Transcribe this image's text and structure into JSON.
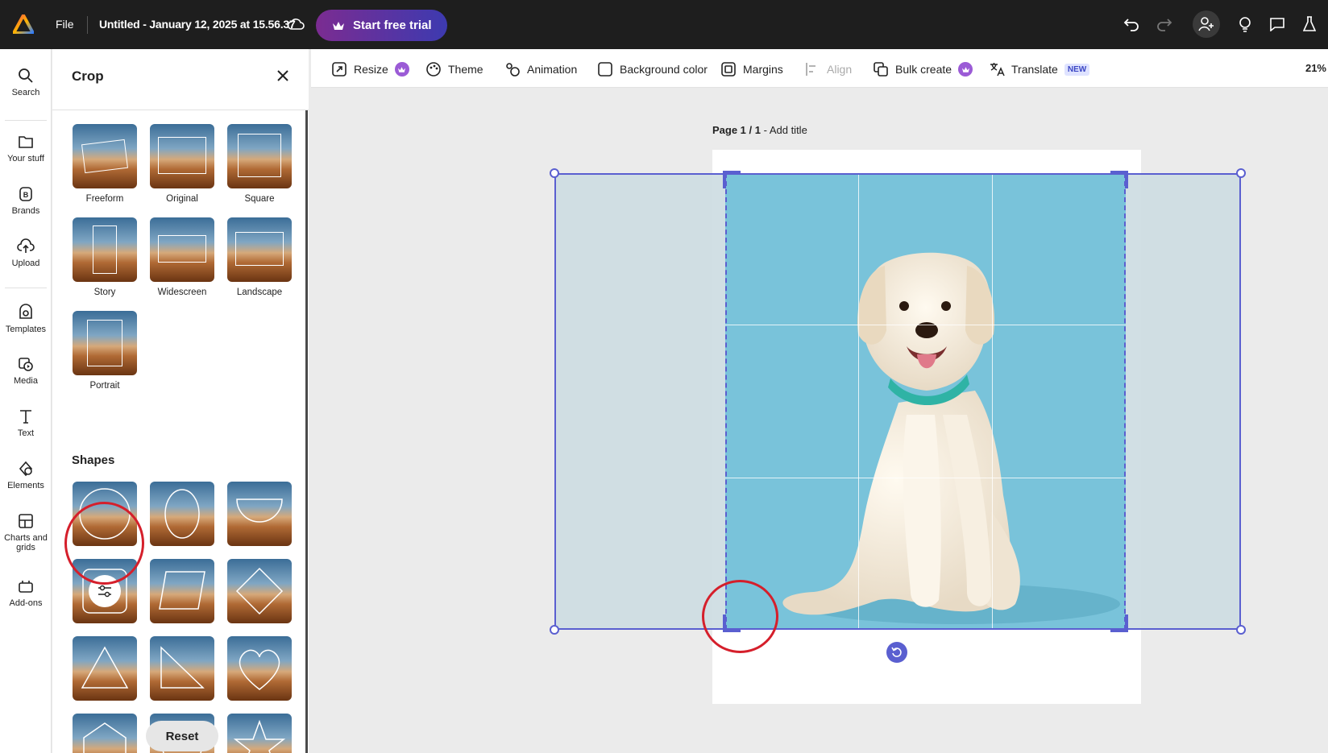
{
  "topbar": {
    "file_label": "File",
    "doc_title": "Untitled - January 12, 2025 at 15.56.37",
    "trial_label": "Start free trial"
  },
  "rail": {
    "items": [
      {
        "label": "Search",
        "icon": "search-icon"
      },
      {
        "label": "Your stuff",
        "icon": "folder-icon"
      },
      {
        "label": "Brands",
        "icon": "brand-icon"
      },
      {
        "label": "Upload",
        "icon": "upload-icon"
      },
      {
        "label": "Templates",
        "icon": "templates-icon"
      },
      {
        "label": "Media",
        "icon": "media-icon"
      },
      {
        "label": "Text",
        "icon": "text-icon"
      },
      {
        "label": "Elements",
        "icon": "elements-icon"
      },
      {
        "label": "Charts and grids",
        "icon": "charts-icon"
      },
      {
        "label": "Add-ons",
        "icon": "addons-icon"
      }
    ]
  },
  "panel": {
    "title": "Crop",
    "ratios": [
      {
        "label": "Freeform"
      },
      {
        "label": "Original"
      },
      {
        "label": "Square"
      },
      {
        "label": "Story"
      },
      {
        "label": "Widescreen"
      },
      {
        "label": "Landscape"
      },
      {
        "label": "Portrait"
      }
    ],
    "shapes_title": "Shapes",
    "shapes": [
      "circle",
      "ellipse",
      "semicircle",
      "rounded-square",
      "parallelogram",
      "diamond",
      "triangle",
      "right-triangle",
      "heart",
      "pentagon-arch",
      "pentagon",
      "star"
    ],
    "reset_label": "Reset"
  },
  "toolbar": {
    "resize": "Resize",
    "theme": "Theme",
    "animation": "Animation",
    "background_color": "Background color",
    "margins": "Margins",
    "align": "Align",
    "bulk_create": "Bulk create",
    "translate": "Translate",
    "new_badge": "NEW",
    "zoom": "21%"
  },
  "canvas": {
    "page_label": "Page 1 / 1",
    "add_title": " - Add title"
  },
  "colors": {
    "accent": "#5a5fd0",
    "annotation": "#d51f2b",
    "photo_bg": "#79c3da"
  }
}
